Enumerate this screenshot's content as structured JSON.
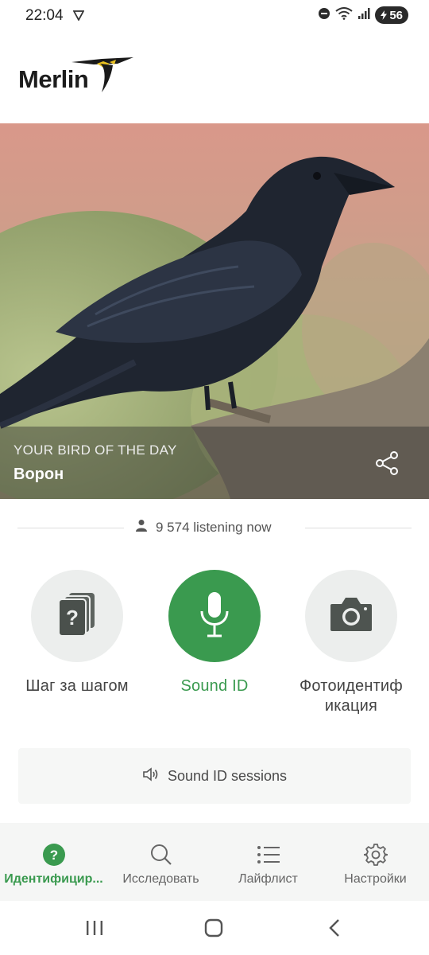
{
  "status_bar": {
    "time": "22:04",
    "battery": "56",
    "icons": [
      "navigation-arrow-icon",
      "do-not-disturb-icon",
      "wifi-icon",
      "signal-icon",
      "battery-icon"
    ]
  },
  "header": {
    "logo_text": "Merlin"
  },
  "hero": {
    "kicker": "YOUR BIRD OF THE DAY",
    "bird_name": "Ворон"
  },
  "listening": {
    "count_text": "9 574 listening now"
  },
  "actions": [
    {
      "label": "Шаг за шагом",
      "icon": "cards-question-icon",
      "color": "#eceeed"
    },
    {
      "label": "Sound ID",
      "icon": "microphone-icon",
      "color": "#3a9a4f"
    },
    {
      "label": "Фотоидентиф икация",
      "label_line1": "Фотоидентиф",
      "label_line2": "икация",
      "icon": "camera-icon",
      "color": "#eceeed"
    }
  ],
  "sessions": {
    "label": "Sound ID sessions"
  },
  "bottom_nav": {
    "items": [
      {
        "label": "Идентифицир...",
        "icon": "question-circle-icon",
        "active": true
      },
      {
        "label": "Исследовать",
        "icon": "search-icon",
        "active": false
      },
      {
        "label": "Лайфлист",
        "icon": "list-icon",
        "active": false
      },
      {
        "label": "Настройки",
        "icon": "gear-icon",
        "active": false
      }
    ]
  },
  "colors": {
    "accent_green": "#3a9a4f",
    "nav_background": "#f5f6f5",
    "action_gray": "#eceeed"
  }
}
